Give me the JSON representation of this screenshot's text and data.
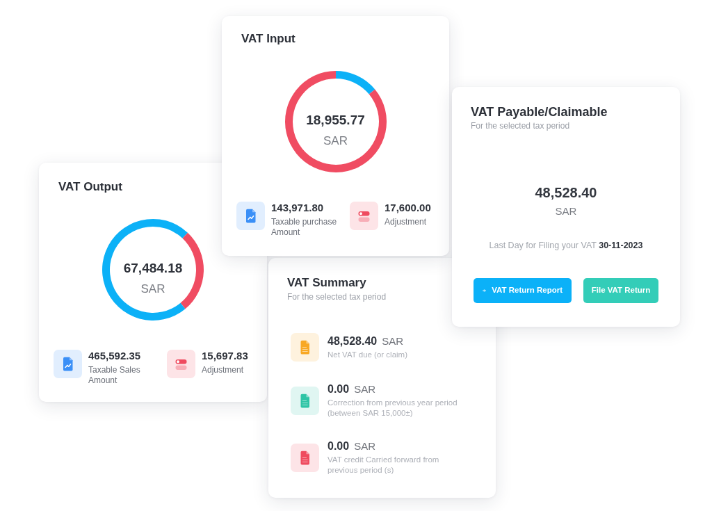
{
  "vat_input": {
    "title": "VAT Input",
    "chart_data": {
      "type": "donut",
      "values": [
        14,
        86
      ],
      "colors": [
        "#0cb1f7",
        "#f04c62"
      ]
    },
    "total": "18,955.77",
    "currency": "SAR",
    "stats": [
      {
        "kind": "chart",
        "color": "#3a8ff7",
        "value": "143,971.80",
        "label": "Taxable purchase Amount"
      },
      {
        "kind": "toggle",
        "color": "#ef4b5f",
        "value": "17,600.00",
        "label": "Adjustment"
      }
    ]
  },
  "vat_payable": {
    "title": "VAT Payable/Claimable",
    "subtitle": "For the selected tax period",
    "amount": "48,528.40",
    "currency": "SAR",
    "deadline": "Last Day for Filing your VAT **30-11-2023**",
    "buttons": [
      {
        "kind": "preview",
        "label": "VAT Return Report"
      },
      {
        "kind": "submit",
        "label": "File VAT Return"
      }
    ]
  },
  "vat_output": {
    "title": "VAT Output",
    "chart_data": {
      "type": "donut",
      "values": [
        12,
        27,
        61
      ],
      "colors": [
        "#0cb1f7",
        "#f04c62",
        "#0cb1f7"
      ]
    },
    "total": "67,484.18",
    "currency": "SAR",
    "stats": [
      {
        "kind": "chart",
        "color": "#3a8ff7",
        "value": "465,592.35",
        "label": "Taxable Sales Amount"
      },
      {
        "kind": "toggle",
        "color": "#ef4b5f",
        "value": "15,697.83",
        "label": "Adjustment"
      }
    ]
  },
  "vat_summary": {
    "title": "VAT Summary",
    "subtitle": "For the selected tax period",
    "items": [
      {
        "color": "#f8a824",
        "amount": "48,528.40",
        "currency": "SAR",
        "description": "Net VAT due (or claim)"
      },
      {
        "color": "#2ec4a5",
        "amount": "0.00",
        "currency": "SAR",
        "description": "Correction from previous year period (between SAR 15,000±)"
      },
      {
        "color": "#ef4b5f",
        "amount": "0.00",
        "currency": "SAR",
        "description": "VAT credit Carried forward from previous period (s)"
      }
    ]
  }
}
